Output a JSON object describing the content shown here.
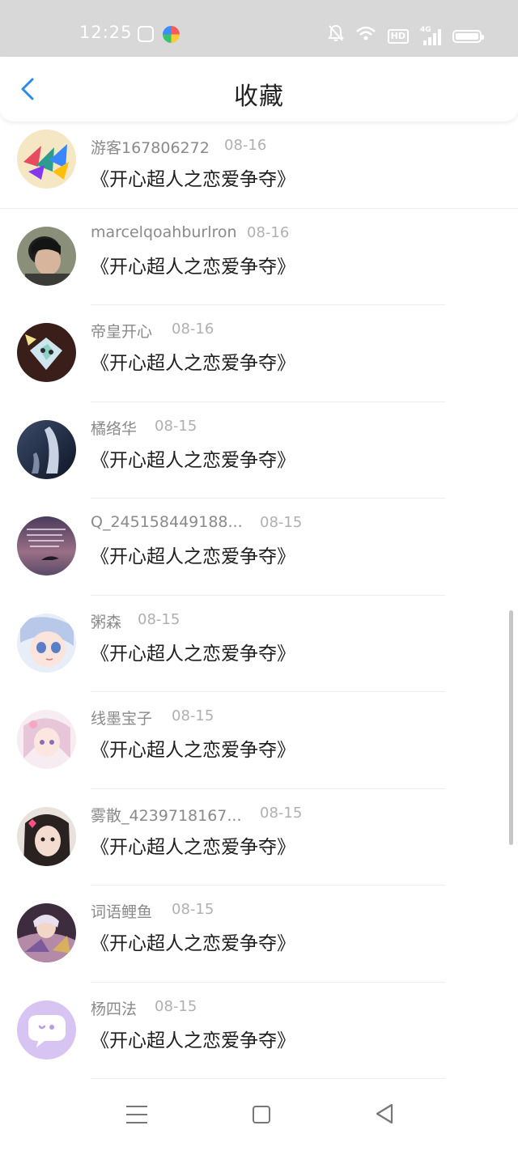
{
  "status_bar": {
    "time": "12:25",
    "hd_label": "HD",
    "network_label": "4G",
    "battery_level": 1.0
  },
  "header": {
    "title": "收藏",
    "back_icon": "chevron-left-icon"
  },
  "list": {
    "items": [
      {
        "user": "游客167806272",
        "date": "08-16",
        "title": "《开心超人之恋爱争夺》"
      },
      {
        "user": "marcelqoahburlron",
        "date": "08-16",
        "title": "《开心超人之恋爱争夺》"
      },
      {
        "user": "帝皇开心",
        "date": "08-16",
        "title": "《开心超人之恋爱争夺》"
      },
      {
        "user": "橘络华",
        "date": "08-15",
        "title": "《开心超人之恋爱争夺》"
      },
      {
        "user": "Q_245158449188...",
        "date": "08-15",
        "title": "《开心超人之恋爱争夺》"
      },
      {
        "user": "粥森",
        "date": "08-15",
        "title": "《开心超人之恋爱争夺》"
      },
      {
        "user": "线墨宝子",
        "date": "08-15",
        "title": "《开心超人之恋爱争夺》"
      },
      {
        "user": "雾散_4239718167...",
        "date": "08-15",
        "title": "《开心超人之恋爱争夺》"
      },
      {
        "user": "词语鲤鱼",
        "date": "08-15",
        "title": "《开心超人之恋爱争夺》"
      },
      {
        "user": "杨四法",
        "date": "08-15",
        "title": "《开心超人之恋爱争夺》"
      }
    ]
  },
  "nav_bar": {
    "menu_icon": "menu-icon",
    "home_icon": "home-square-icon",
    "back_icon": "back-triangle-icon"
  },
  "colors": {
    "status_bar_bg": "#d8d8d8",
    "accent_blue": "#2b8ce8",
    "username_gray": "#8a8a8a",
    "date_gray": "#b0b0b0",
    "title_black": "#1f1f1f",
    "assistant_avatar_bg": "#d8c4f2"
  }
}
